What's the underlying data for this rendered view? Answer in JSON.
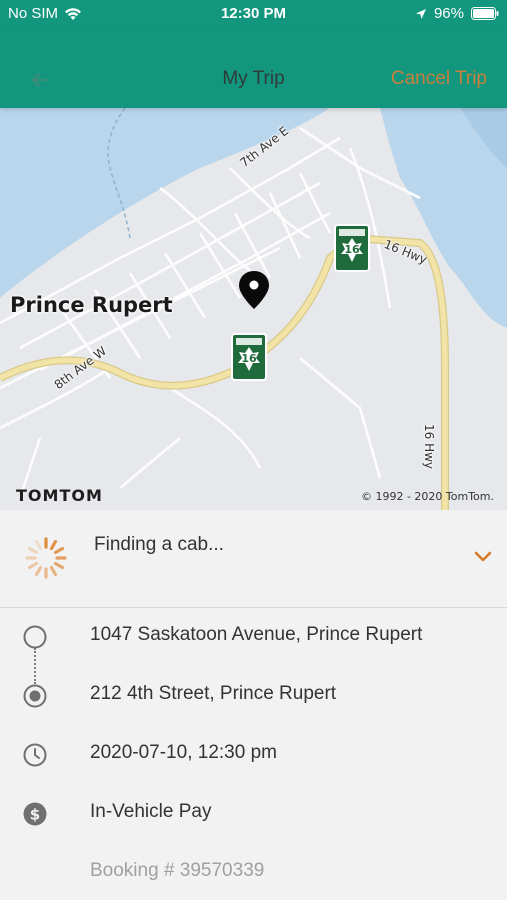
{
  "status_bar": {
    "carrier": "No SIM",
    "time": "12:30 PM",
    "battery": "96%"
  },
  "nav": {
    "title": "My Trip",
    "cancel_label": "Cancel Trip",
    "back_icon": "back-arrow-icon"
  },
  "map": {
    "city_label": "Prince Rupert",
    "roads": [
      "7th Ave E",
      "16 Hwy",
      "8th Ave W",
      "16 Hwy"
    ],
    "shield_number": "16",
    "logo": "TOMTOM",
    "copyright": "© 1992 - 2020 TomTom."
  },
  "trip_status": {
    "text": "Finding a cab...",
    "accent": "#e08a3a"
  },
  "details": {
    "pickup": "1047 Saskatoon Avenue, Prince Rupert",
    "dropoff": "212 4th Street, Prince Rupert",
    "datetime": "2020-07-10, 12:30 pm",
    "payment": "In-Vehicle Pay",
    "booking": "Booking # 39570339"
  },
  "colors": {
    "header": "#12977e",
    "cancel": "#c9803c",
    "water": "#b9d6ec",
    "park": "#cfe3cf",
    "highway": "#f2e3a6"
  }
}
